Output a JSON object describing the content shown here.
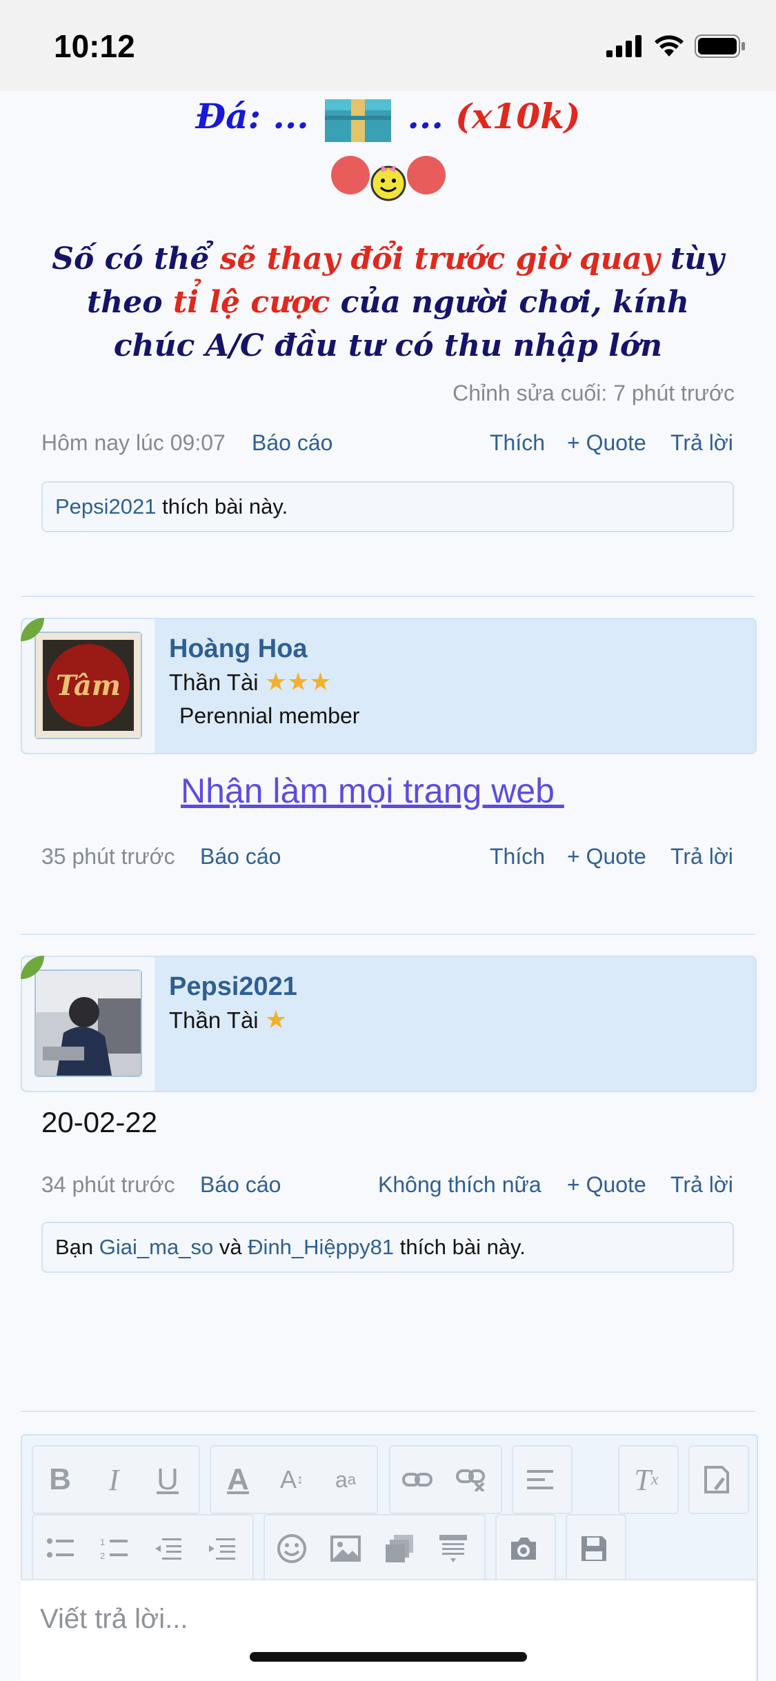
{
  "status_bar": {
    "time": "10:12"
  },
  "post1": {
    "line1_prefix": "Đá: ...",
    "line1_suffix": "...",
    "line1_multiplier": "(x10k)",
    "note_part1": "Số có thể ",
    "note_part2": "sẽ thay đổi trước giờ quay",
    "note_part3": " tùy theo ",
    "note_part4": "tỉ lệ cược",
    "note_part5": " của người chơi, kính chúc A/C đầu tư có thu nhập lớn",
    "edited": "Chỉnh sửa cuối: 7 phút trước",
    "time": "Hôm nay lúc 09:07",
    "report": "Báo cáo",
    "like": "Thích",
    "quote": "+ Quote",
    "reply": "Trả lời",
    "likes_user": "Pepsi2021",
    "likes_text": " thích bài này."
  },
  "post2": {
    "username": "Hoàng Hoa",
    "title": "Thần Tài",
    "stars": 3,
    "subtitle": "Perennial member",
    "avatar_text": "Tâm",
    "body_link": "Nhận làm mọi trang web ",
    "time": "35 phút trước",
    "report": "Báo cáo",
    "like": "Thích",
    "quote": "+ Quote",
    "reply": "Trả lời"
  },
  "post3": {
    "username": "Pepsi2021",
    "title": "Thần Tài",
    "stars": 1,
    "body": "20-02-22",
    "time": "34 phút trước",
    "report": "Báo cáo",
    "unlike": "Không thích nữa",
    "quote": "+ Quote",
    "reply": "Trả lời",
    "likes_prefix": "Bạn ",
    "likes_user1": "Giai_ma_so",
    "likes_and": " và ",
    "likes_user2": "Đinh_Hiệppy81",
    "likes_text": " thích bài này."
  },
  "editor": {
    "placeholder": "Viết trả lời...",
    "toolbar_icons": [
      "bold-icon",
      "italic-icon",
      "underline-icon",
      "font-color-icon",
      "font-size-icon",
      "font-family-icon",
      "link-icon",
      "unlink-icon",
      "align-icon",
      "remove-format-icon",
      "smilie-icon",
      "image-icon",
      "media-icon",
      "spoiler-icon",
      "camera-icon",
      "save-draft-icon"
    ]
  },
  "colors": {
    "accent_blue": "#2e5f93",
    "post_red": "#e0281c",
    "post_navy": "#15146a",
    "post_blue": "#1818d8",
    "link_purple": "#5a4de0"
  }
}
